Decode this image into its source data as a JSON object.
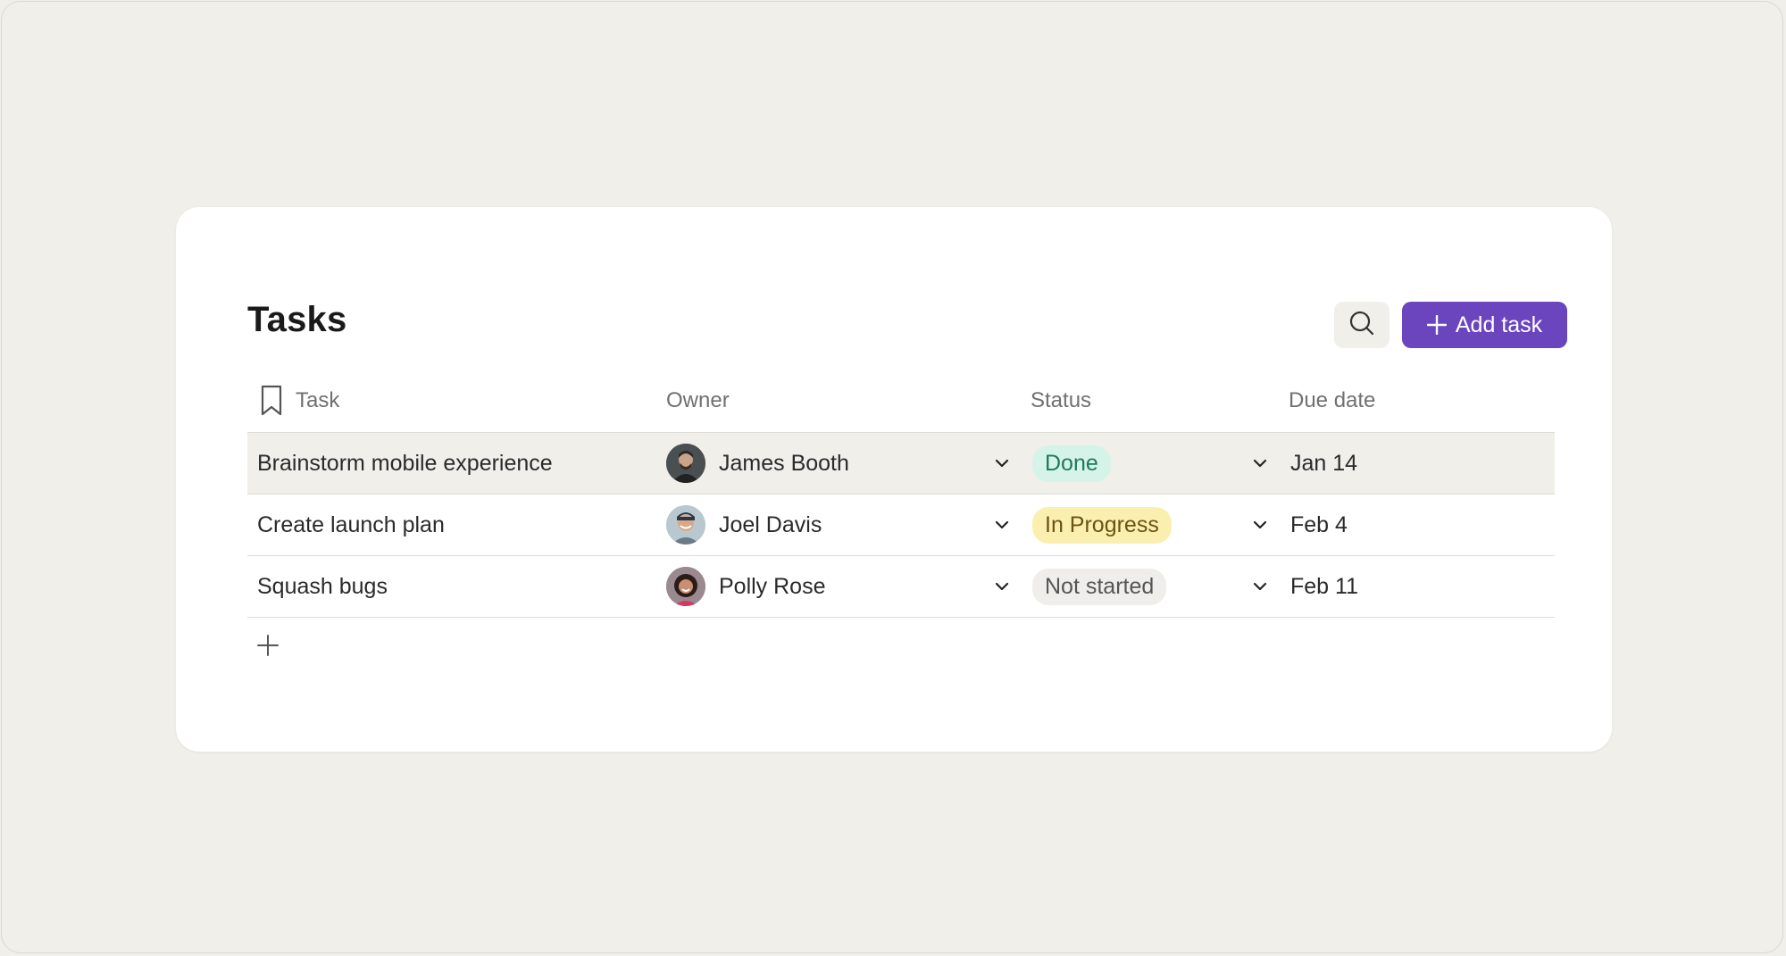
{
  "page": {
    "title": "Tasks"
  },
  "toolbar": {
    "search_icon": "search-icon",
    "add_label": "Add task",
    "add_icon": "plus-icon",
    "accent_color": "#6b45be"
  },
  "table": {
    "columns": {
      "task": "Task",
      "owner": "Owner",
      "status": "Status",
      "due": "Due date"
    },
    "task_header_icon": "bookmark-icon",
    "rows": [
      {
        "task": "Brainstorm mobile experience",
        "owner": "James Booth",
        "status": "Done",
        "status_color": "#d6f3ea",
        "status_text_color": "#1e7a5c",
        "due": "Jan 14",
        "highlighted": true
      },
      {
        "task": "Create launch plan",
        "owner": "Joel Davis",
        "status": "In Progress",
        "status_color": "#fbefb0",
        "status_text_color": "#6b5412",
        "due": "Feb 4",
        "highlighted": false
      },
      {
        "task": "Squash bugs",
        "owner": "Polly Rose",
        "status": "Not started",
        "status_color": "#efeeea",
        "status_text_color": "#555555",
        "due": "Feb 11",
        "highlighted": false
      }
    ],
    "add_row_icon": "plus-icon"
  }
}
